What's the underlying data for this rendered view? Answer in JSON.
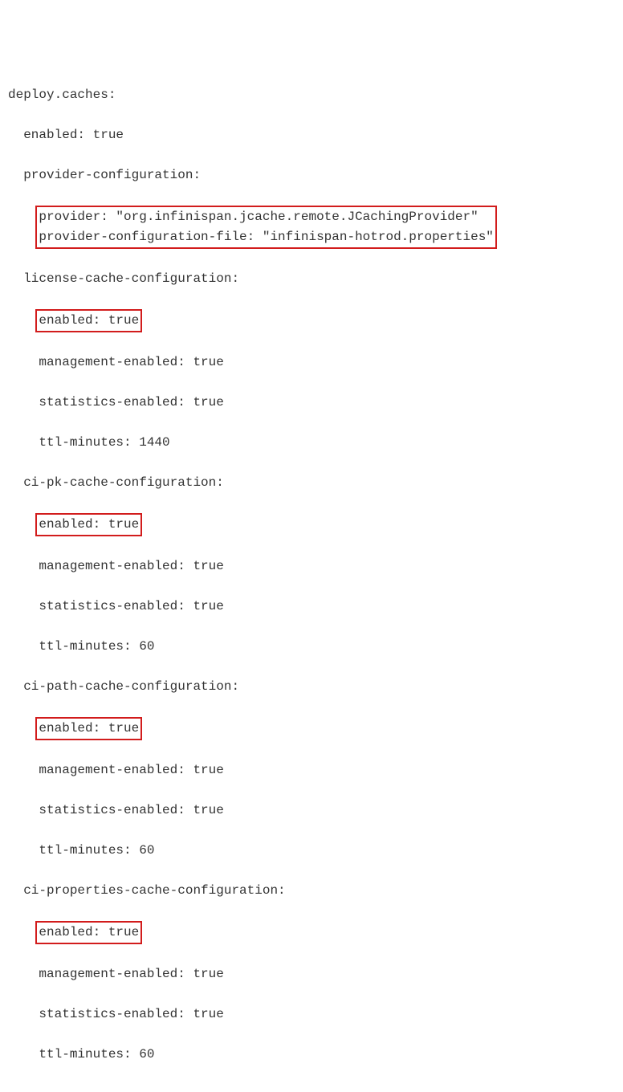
{
  "root": {
    "key": "deploy.caches:"
  },
  "enabled": "enabled: true",
  "providerConfig": {
    "key": "provider-configuration:",
    "provider": "provider: \"org.infinispan.jcache.remote.JCachingProvider\"",
    "providerFile": "provider-configuration-file: \"infinispan-hotrod.properties\""
  },
  "license": {
    "key": "license-cache-configuration:",
    "enabled": "enabled: true",
    "mgmt": "management-enabled: true",
    "stats": "statistics-enabled: true",
    "ttl": "ttl-minutes: 1440"
  },
  "ciPk": {
    "key": "ci-pk-cache-configuration:",
    "enabled": "enabled: true",
    "mgmt": "management-enabled: true",
    "stats": "statistics-enabled: true",
    "ttl": "ttl-minutes: 60"
  },
  "ciPath": {
    "key": "ci-path-cache-configuration:",
    "enabled": "enabled: true",
    "mgmt": "management-enabled: true",
    "stats": "statistics-enabled: true",
    "ttl": "ttl-minutes: 60"
  },
  "ciProps": {
    "key": "ci-properties-cache-configuration:",
    "enabled": "enabled: true",
    "mgmt": "management-enabled: true",
    "stats": "statistics-enabled: true",
    "ttl": "ttl-minutes: 60"
  }
}
